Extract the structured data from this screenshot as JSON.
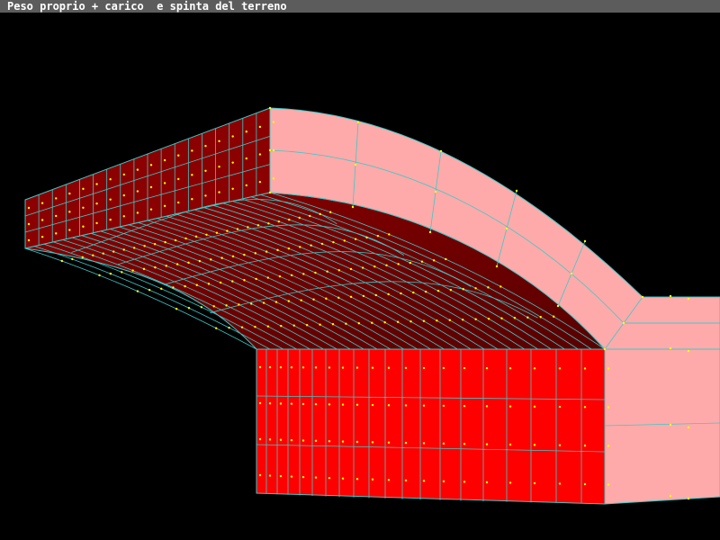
{
  "window": {
    "title": "Peso proprio + carico  e spinta del terreno"
  },
  "colors": {
    "background": "#000000",
    "titlebar": "#5c5c5c",
    "title_text": "#ffffff",
    "mesh_lines": "#3ec8c8",
    "nodes": "#ffff00",
    "slab_top": "#8b0000",
    "vault_intrados": "#7a0000",
    "wall_face": "#ff0000",
    "pink_faces": "#ffaaaa"
  },
  "icons": {
    "mesh": "finite-element-mesh"
  }
}
